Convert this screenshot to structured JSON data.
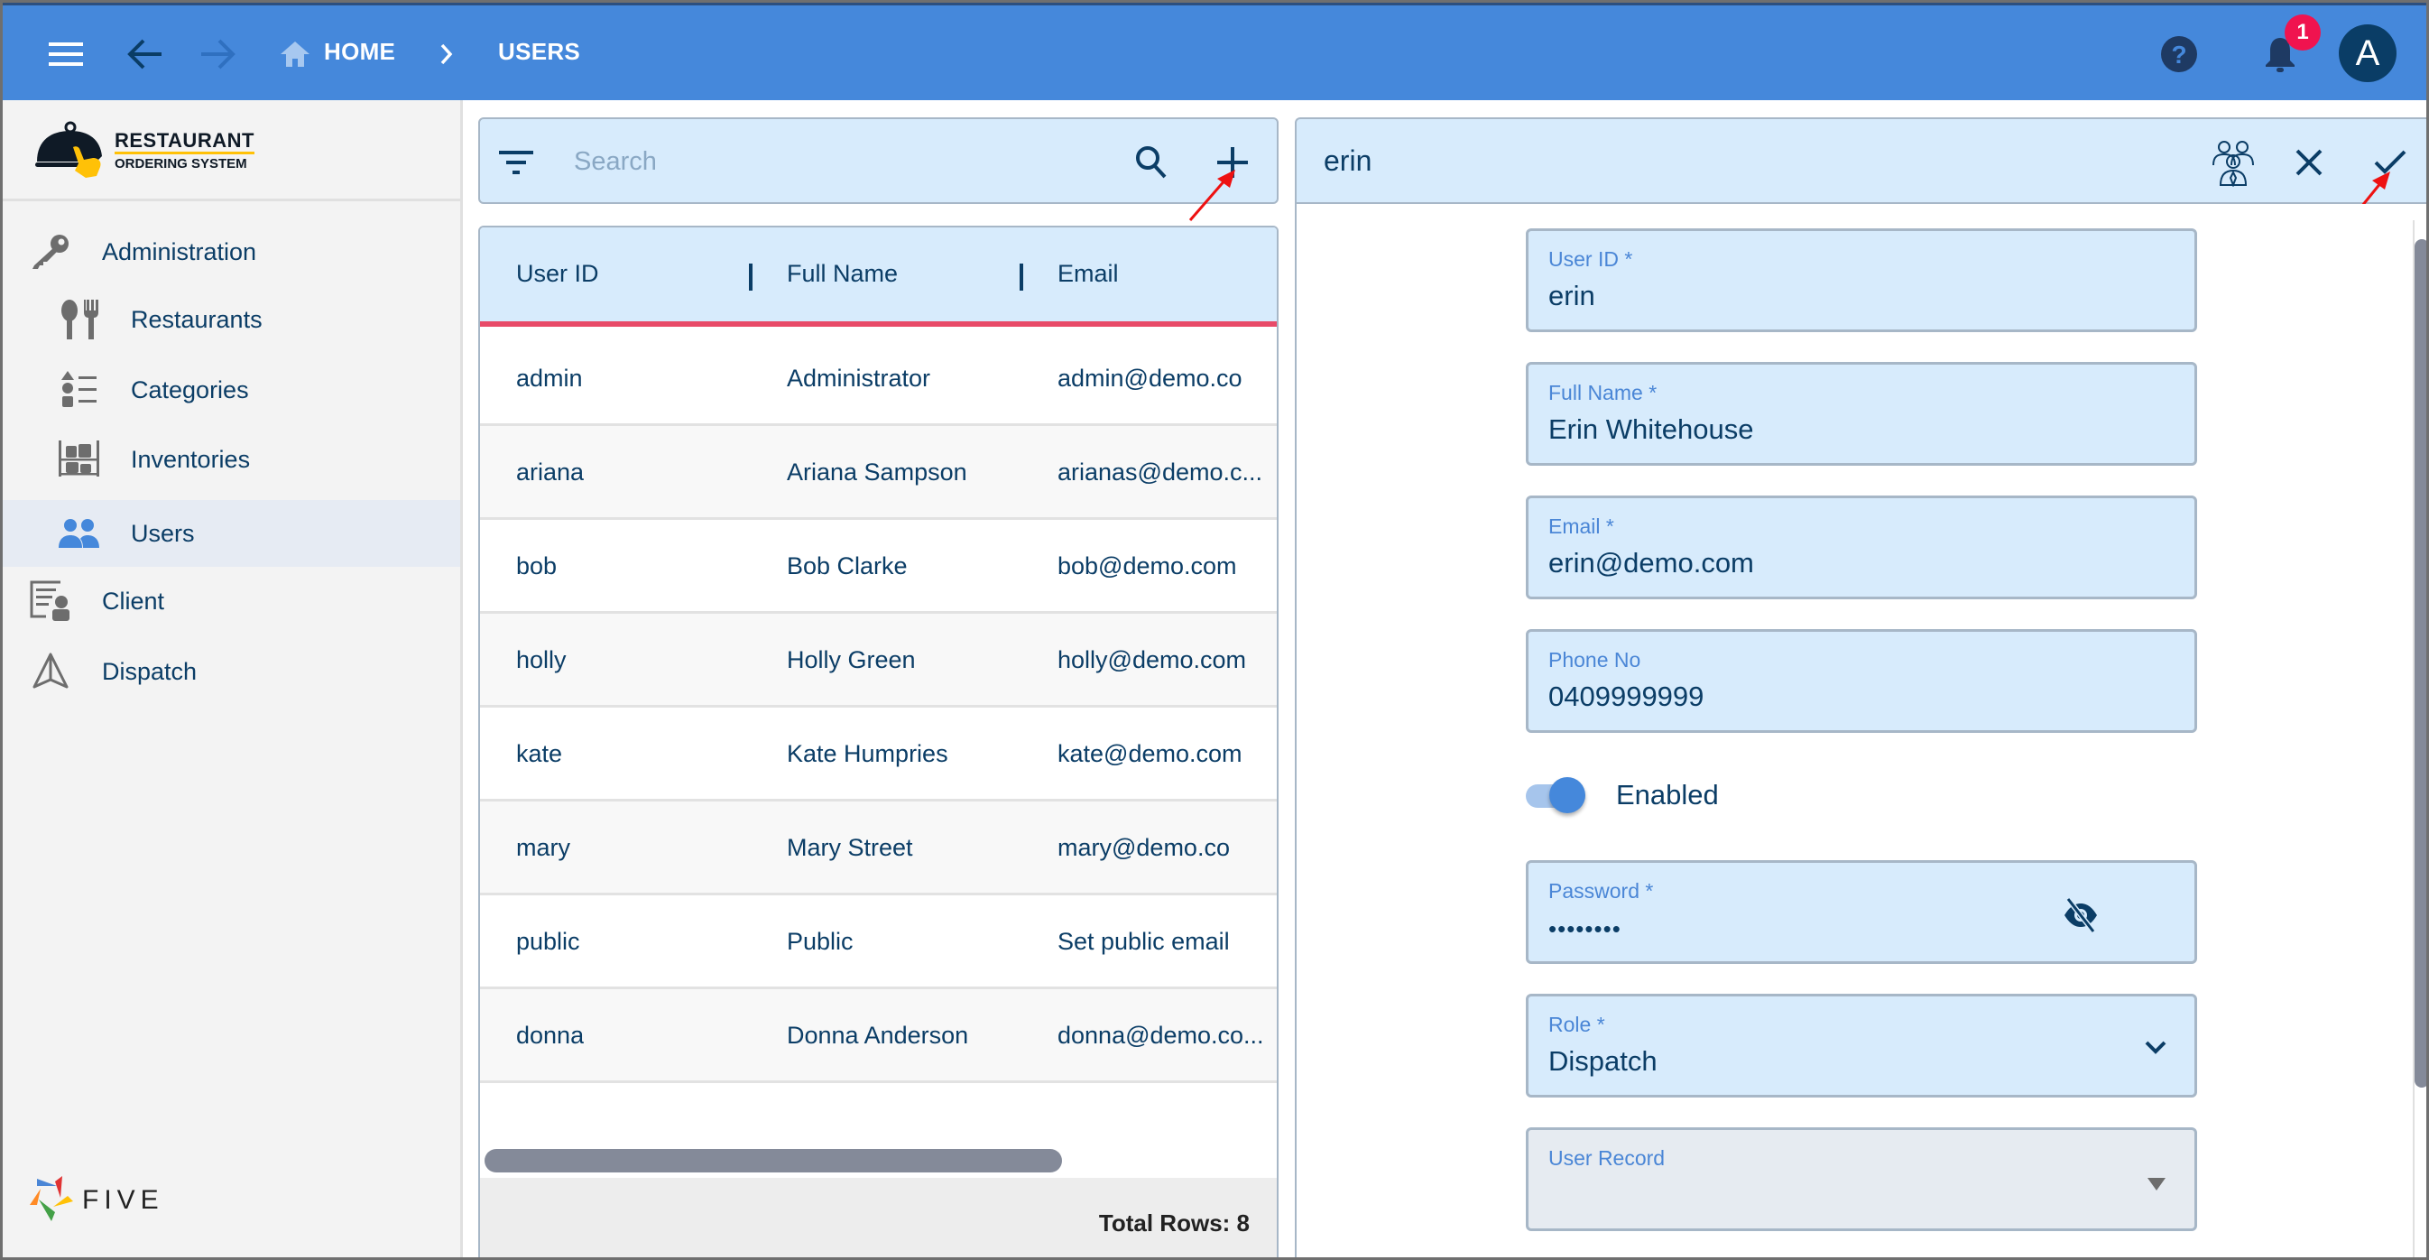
{
  "topbar": {
    "breadcrumb": [
      {
        "label": "HOME",
        "icon": "home-icon"
      },
      {
        "label": "USERS"
      }
    ],
    "notification_count": "1",
    "avatar_initial": "A",
    "colors": {
      "bar": "#4588db",
      "badge": "#f0134f",
      "avatar": "#0a3d66"
    }
  },
  "sidebar": {
    "logo": {
      "title": "RESTAURANT",
      "subtitle": "ORDERING SYSTEM"
    },
    "items": [
      {
        "label": "Administration",
        "icon": "key-icon",
        "level": 0
      },
      {
        "label": "Restaurants",
        "icon": "cutlery-icon",
        "level": 1
      },
      {
        "label": "Categories",
        "icon": "categories-list-icon",
        "level": 1
      },
      {
        "label": "Inventories",
        "icon": "shelves-icon",
        "level": 1
      },
      {
        "label": "Users",
        "icon": "users-icon",
        "level": 1,
        "active": true
      },
      {
        "label": "Client",
        "icon": "client-icon",
        "level": 0
      },
      {
        "label": "Dispatch",
        "icon": "dispatch-icon",
        "level": 0
      }
    ],
    "footer_brand": "FIVE"
  },
  "list": {
    "search": {
      "placeholder": "Search",
      "value": ""
    },
    "columns": [
      "User ID",
      "Full Name",
      "Email"
    ],
    "rows": [
      [
        "admin",
        "Administrator",
        "admin@demo.co"
      ],
      [
        "ariana",
        "Ariana Sampson",
        "arianas@demo.c..."
      ],
      [
        "bob",
        "Bob Clarke",
        "bob@demo.com"
      ],
      [
        "holly",
        "Holly Green",
        "holly@demo.com"
      ],
      [
        "kate",
        "Kate Humpries",
        "kate@demo.com"
      ],
      [
        "mary",
        "Mary Street",
        "mary@demo.co"
      ],
      [
        "public",
        "Public",
        "Set public email"
      ],
      [
        "donna",
        "Donna Anderson",
        "donna@demo.co..."
      ]
    ],
    "total_rows": "Total Rows: 8"
  },
  "form": {
    "title": "erin",
    "fields": {
      "user_id": {
        "label": "User ID *",
        "value": "erin"
      },
      "full_name": {
        "label": "Full Name *",
        "value": "Erin Whitehouse"
      },
      "email": {
        "label": "Email *",
        "value": "erin@demo.com"
      },
      "phone": {
        "label": "Phone No",
        "value": "0409999999"
      },
      "enabled": {
        "label": "Enabled",
        "checked": true
      },
      "password": {
        "label": "Password *",
        "value": "••••••••"
      },
      "role": {
        "label": "Role *",
        "value": "Dispatch"
      },
      "user_record": {
        "label": "User Record",
        "value": ""
      }
    }
  }
}
